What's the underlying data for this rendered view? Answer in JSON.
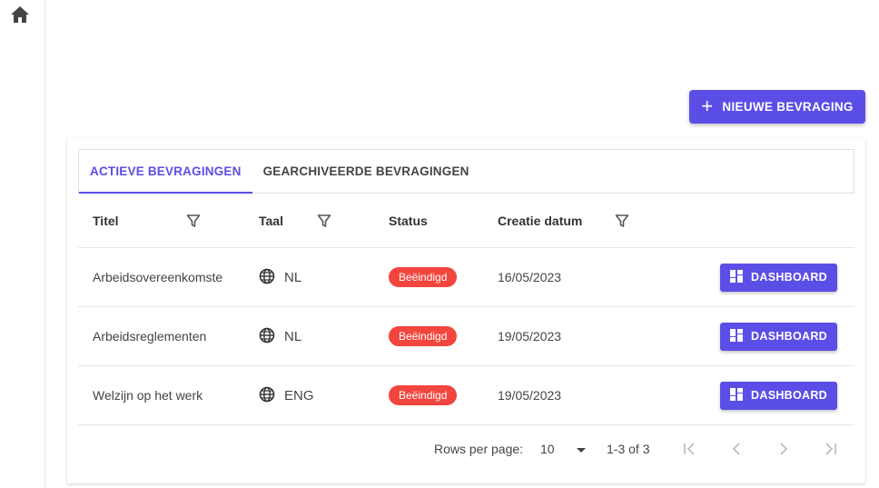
{
  "sidebar": {
    "home_icon": "home-icon"
  },
  "actions": {
    "new_label": "NIEUWE BEVRAGING"
  },
  "tabs": [
    {
      "label": "ACTIEVE BEVRAGINGEN",
      "active": true
    },
    {
      "label": "GEARCHIVEERDE BEVRAGINGEN",
      "active": false
    }
  ],
  "table": {
    "columns": {
      "title": "Titel",
      "lang": "Taal",
      "status": "Status",
      "date": "Creatie datum"
    },
    "rows": [
      {
        "title": "Arbeidsovereenkomste",
        "lang": "NL",
        "status": "Beëindigd",
        "date": "16/05/2023",
        "action": "DASHBOARD"
      },
      {
        "title": "Arbeidsreglementen",
        "lang": "NL",
        "status": "Beëindigd",
        "date": "19/05/2023",
        "action": "DASHBOARD"
      },
      {
        "title": "Welzijn op het werk",
        "lang": "ENG",
        "status": "Beëindigd",
        "date": "19/05/2023",
        "action": "DASHBOARD"
      }
    ]
  },
  "pagination": {
    "rows_per_page_label": "Rows per page:",
    "rows_per_page": "10",
    "range": "1-3 of 3"
  },
  "colors": {
    "primary": "#5b4ee6",
    "status_ended": "#f2453d"
  }
}
